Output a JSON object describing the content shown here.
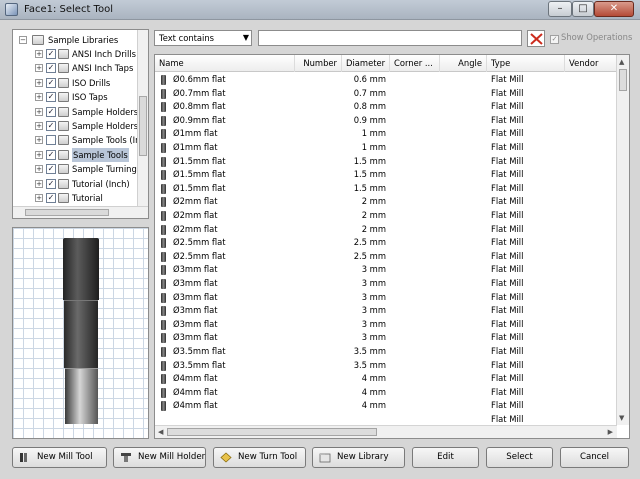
{
  "window": {
    "title": "Face1: Select Tool",
    "min_glyph": "–",
    "max_glyph": "□",
    "close_glyph": "✕"
  },
  "tree": {
    "root": "Sample Libraries",
    "items": [
      {
        "label": "ANSI Inch Drills",
        "checked": true,
        "selected": false
      },
      {
        "label": "ANSI Inch Taps",
        "checked": true,
        "selected": false
      },
      {
        "label": "ISO Drills",
        "checked": true,
        "selected": false
      },
      {
        "label": "ISO Taps",
        "checked": true,
        "selected": false
      },
      {
        "label": "Sample Holders",
        "checked": true,
        "selected": false
      },
      {
        "label": "Sample Holders",
        "checked": true,
        "selected": false
      },
      {
        "label": "Sample Tools (Ir",
        "checked": false,
        "selected": false
      },
      {
        "label": "Sample Tools",
        "checked": true,
        "selected": true
      },
      {
        "label": "Sample Turning",
        "checked": true,
        "selected": false
      },
      {
        "label": "Tutorial (Inch)",
        "checked": true,
        "selected": false
      },
      {
        "label": "Tutorial",
        "checked": true,
        "selected": false
      }
    ]
  },
  "filter": {
    "mode": "Text contains",
    "search_value": "",
    "search_placeholder": "",
    "show_operations_label": "Show Operations",
    "show_operations_checked": true
  },
  "table": {
    "columns": [
      "Name",
      "Number",
      "Diameter",
      "Corner ...",
      "Angle",
      "Type",
      "Vendor"
    ],
    "rows": [
      {
        "name": "Ø0.6mm flat",
        "number": "",
        "diameter": "0.6 mm",
        "corner": "",
        "angle": "",
        "type": "Flat Mill",
        "vendor": ""
      },
      {
        "name": "Ø0.7mm flat",
        "number": "",
        "diameter": "0.7 mm",
        "corner": "",
        "angle": "",
        "type": "Flat Mill",
        "vendor": ""
      },
      {
        "name": "Ø0.8mm flat",
        "number": "",
        "diameter": "0.8 mm",
        "corner": "",
        "angle": "",
        "type": "Flat Mill",
        "vendor": ""
      },
      {
        "name": "Ø0.9mm flat",
        "number": "",
        "diameter": "0.9 mm",
        "corner": "",
        "angle": "",
        "type": "Flat Mill",
        "vendor": ""
      },
      {
        "name": "Ø1mm flat",
        "number": "",
        "diameter": "1 mm",
        "corner": "",
        "angle": "",
        "type": "Flat Mill",
        "vendor": ""
      },
      {
        "name": "Ø1mm flat",
        "number": "",
        "diameter": "1 mm",
        "corner": "",
        "angle": "",
        "type": "Flat Mill",
        "vendor": ""
      },
      {
        "name": "Ø1.5mm flat",
        "number": "",
        "diameter": "1.5 mm",
        "corner": "",
        "angle": "",
        "type": "Flat Mill",
        "vendor": ""
      },
      {
        "name": "Ø1.5mm flat",
        "number": "",
        "diameter": "1.5 mm",
        "corner": "",
        "angle": "",
        "type": "Flat Mill",
        "vendor": ""
      },
      {
        "name": "Ø1.5mm flat",
        "number": "",
        "diameter": "1.5 mm",
        "corner": "",
        "angle": "",
        "type": "Flat Mill",
        "vendor": ""
      },
      {
        "name": "Ø2mm flat",
        "number": "",
        "diameter": "2 mm",
        "corner": "",
        "angle": "",
        "type": "Flat Mill",
        "vendor": ""
      },
      {
        "name": "Ø2mm flat",
        "number": "",
        "diameter": "2 mm",
        "corner": "",
        "angle": "",
        "type": "Flat Mill",
        "vendor": ""
      },
      {
        "name": "Ø2mm flat",
        "number": "",
        "diameter": "2 mm",
        "corner": "",
        "angle": "",
        "type": "Flat Mill",
        "vendor": ""
      },
      {
        "name": "Ø2.5mm flat",
        "number": "",
        "diameter": "2.5 mm",
        "corner": "",
        "angle": "",
        "type": "Flat Mill",
        "vendor": ""
      },
      {
        "name": "Ø2.5mm flat",
        "number": "",
        "diameter": "2.5 mm",
        "corner": "",
        "angle": "",
        "type": "Flat Mill",
        "vendor": ""
      },
      {
        "name": "Ø3mm flat",
        "number": "",
        "diameter": "3 mm",
        "corner": "",
        "angle": "",
        "type": "Flat Mill",
        "vendor": ""
      },
      {
        "name": "Ø3mm flat",
        "number": "",
        "diameter": "3 mm",
        "corner": "",
        "angle": "",
        "type": "Flat Mill",
        "vendor": ""
      },
      {
        "name": "Ø3mm flat",
        "number": "",
        "diameter": "3 mm",
        "corner": "",
        "angle": "",
        "type": "Flat Mill",
        "vendor": ""
      },
      {
        "name": "Ø3mm flat",
        "number": "",
        "diameter": "3 mm",
        "corner": "",
        "angle": "",
        "type": "Flat Mill",
        "vendor": ""
      },
      {
        "name": "Ø3mm flat",
        "number": "",
        "diameter": "3 mm",
        "corner": "",
        "angle": "",
        "type": "Flat Mill",
        "vendor": ""
      },
      {
        "name": "Ø3mm flat",
        "number": "",
        "diameter": "3 mm",
        "corner": "",
        "angle": "",
        "type": "Flat Mill",
        "vendor": ""
      },
      {
        "name": "Ø3.5mm flat",
        "number": "",
        "diameter": "3.5 mm",
        "corner": "",
        "angle": "",
        "type": "Flat Mill",
        "vendor": ""
      },
      {
        "name": "Ø3.5mm flat",
        "number": "",
        "diameter": "3.5 mm",
        "corner": "",
        "angle": "",
        "type": "Flat Mill",
        "vendor": ""
      },
      {
        "name": "Ø4mm flat",
        "number": "",
        "diameter": "4 mm",
        "corner": "",
        "angle": "",
        "type": "Flat Mill",
        "vendor": ""
      },
      {
        "name": "Ø4mm flat",
        "number": "",
        "diameter": "4 mm",
        "corner": "",
        "angle": "",
        "type": "Flat Mill",
        "vendor": ""
      },
      {
        "name": "Ø4mm flat",
        "number": "",
        "diameter": "4 mm",
        "corner": "",
        "angle": "",
        "type": "Flat Mill",
        "vendor": ""
      },
      {
        "name": "",
        "number": "",
        "diameter": "",
        "corner": "",
        "angle": "",
        "type": "Flat Mill",
        "vendor": ""
      }
    ]
  },
  "buttons": {
    "new_mill_tool": "New Mill Tool",
    "new_mill_holder": "New Mill Holder",
    "new_turn_tool": "New Turn Tool",
    "new_library": "New Library",
    "edit": "Edit",
    "select": "Select",
    "cancel": "Cancel"
  },
  "icons": {
    "clear_filter": "red-x-icon",
    "mill_tool": "end-mill-icon",
    "mill_holder": "holder-icon",
    "turn_tool": "turn-insert-icon",
    "library": "library-icon",
    "tree_folder": "library-folder-icon"
  },
  "colors": {
    "clear_x": "#cc2b1d",
    "selection": "#b9c6d8",
    "grid": "#ccd7e4"
  }
}
